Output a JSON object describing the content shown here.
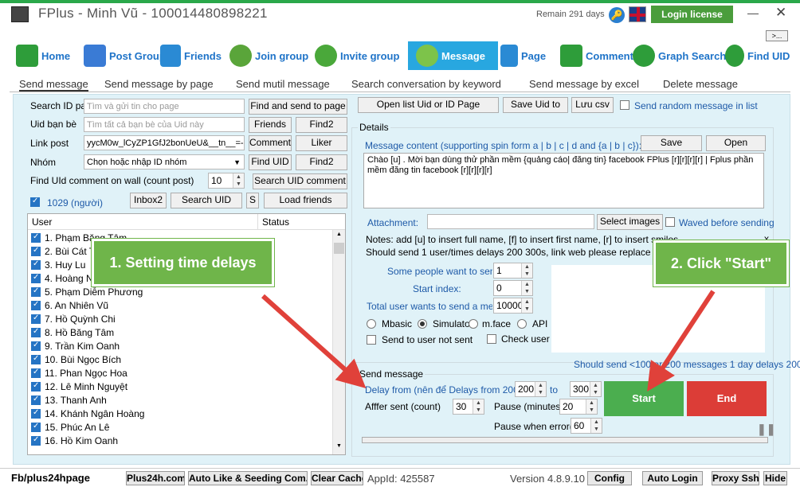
{
  "title": "FPlus - Minh Vũ - 100014480898221",
  "remain": "Remain 291 days",
  "login_license": "Login license",
  "more": ">...",
  "nav": [
    {
      "label": "Home",
      "color": "#2e9d3a"
    },
    {
      "label": "Post Group",
      "color": "#3a7bd5"
    },
    {
      "label": "Friends",
      "color": "#2a8ad4"
    },
    {
      "label": "Join group",
      "color": "#5aa53a"
    },
    {
      "label": "Invite group",
      "color": "#4aa83a"
    },
    {
      "label": "Message",
      "color": "#7dc34a"
    },
    {
      "label": "Page",
      "color": "#2a8ad4"
    },
    {
      "label": "Comment",
      "color": "#2e9d3a"
    },
    {
      "label": "Graph Search",
      "color": "#2e9d3a"
    },
    {
      "label": "Find UID",
      "color": "#2e9d3a"
    }
  ],
  "subtabs": [
    "Send message",
    "Send message by page",
    "Send mutil message",
    "Search conversation by keyword",
    "Send message by excel",
    "Delete message"
  ],
  "left": {
    "search_id_page": "Search ID pag",
    "search_id_ph": "Tìm và gửi tin cho page",
    "find_send_page": "Find and send to page",
    "uid_ban_be": "Uid bạn bè",
    "uid_ph": "Tìm tất cả bạn bè của Uid này",
    "friends": "Friends",
    "find2a": "Find2",
    "link_post": "Link post",
    "link_val": "yycM0w_lCyZP1GfJ2bonUeU&__tn__=-R",
    "comment": "Comment",
    "liker": "Liker",
    "nhom": "Nhóm",
    "nhom_val": "Chọn hoặc nhập ID nhóm",
    "find_uid": "Find UID",
    "find2b": "Find2",
    "find_uid_comment": "Find UId comment on wall (count post)",
    "count_post": "10",
    "search_uid_comment": "Search UID comment",
    "count_label": "1029 (người)",
    "inbox2": "Inbox2",
    "search_uid": "Search UID",
    "s": "S",
    "load_friends": "Load friends"
  },
  "list": {
    "col_user": "User",
    "col_status": "Status",
    "users": [
      "1. Phạm Băng Tâm",
      "2. Bùi Cát Thảo",
      "3. Huy Lu",
      "4. Hoàng Ngọc Khánh",
      "5. Phạm Diễm Phương",
      "6. An Nhiên Vũ",
      "7. Hồ Quỳnh Chi",
      "8. Hồ Băng Tâm",
      "9. Trần Kim Oanh",
      "10. Bùi Ngọc Bích",
      "11. Phan Ngọc Hoa",
      "12. Lê Minh Nguyệt",
      "13. Thanh Anh",
      "14. Khánh Ngân Hoàng",
      "15. Phúc An Lê",
      "16. Hồ Kim Oanh"
    ]
  },
  "right": {
    "open_list": "Open list Uid or ID Page",
    "save_uid_to": "Save Uid to",
    "luu_csv": "Lưu csv",
    "send_random": "Send random message in list",
    "details": "Details",
    "msg_content_label": "Message content (supporting spin form a | b | c | d and {a | b | c}):",
    "save": "Save",
    "open": "Open",
    "message": "Chào [u] . Mời bạn dùng thử phần mềm {quảng cáo| đăng tin} facebook FPlus [r][r][r][r] | Fplus phần mềm đăng tin facebook [r][r][r][r]",
    "attachment": "Attachment:",
    "select_images": "Select images",
    "waved": "Waved before sending",
    "notes": "Notes: add [u] to insert full name, [f] to insert first name, [r] to insert smiles",
    "x": "x",
    "should_send": "Should send 1 user/times delays 200 300s, link web please replace to text (e",
    "some_people": "Some people want to send /",
    "some_val": "1",
    "start_index": "Start index:",
    "start_val": "0",
    "total_user": "Total user wants to send a messa",
    "total_val": "10000",
    "r_mbasic": "Mbasic",
    "r_simulator": "Simulator",
    "r_mface": "m.face",
    "r_api": "API",
    "send_unsent": "Send to user not sent",
    "check_user": "Check user se",
    "advice": "Should send <100 or 200 messages 1 day delays 200",
    "send_message": "Send message",
    "delay_from": "Delay from (nên để Delays from 200>30",
    "delay_from_val": "200",
    "to": "to",
    "delay_to_val": "300",
    "after_sent": "Afffer sent (count)",
    "after_val": "30",
    "pause_min": "Pause (minutes)",
    "pause_val": "20",
    "pause_error": "Pause when error(m)",
    "pause_error_val": "60",
    "start": "Start",
    "end": "End"
  },
  "callout1": "1. Setting time delays",
  "callout2": "2. Click \"Start\"",
  "status": {
    "fb": "Fb/plus24hpage",
    "plus24h": "Plus24h.com",
    "auto_like": "Auto Like & Seeding Com...",
    "clear_cache": "Clear Cache",
    "appid": "AppId: 425587",
    "version": "Version 4.8.9.10",
    "config": "Config",
    "auto_login": "Auto Login",
    "proxy": "Proxy Ssh",
    "hide": "Hide"
  }
}
